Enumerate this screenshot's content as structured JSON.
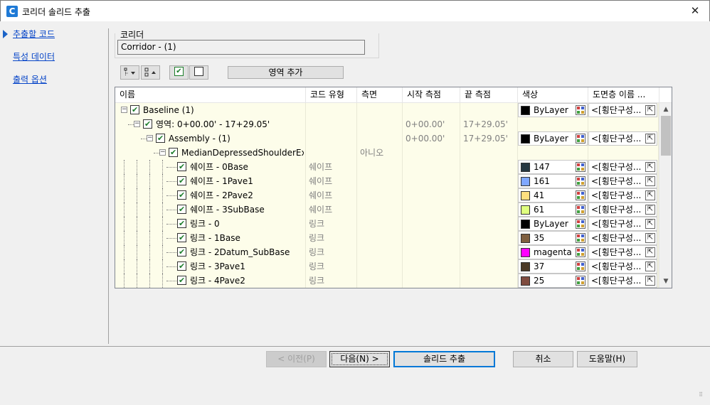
{
  "window": {
    "title": "코리더 솔리드 추출",
    "app_icon": "C",
    "close_glyph": "✕"
  },
  "nav": {
    "items": [
      {
        "label": "추출할 코드",
        "active": true
      },
      {
        "label": "특성 데이터",
        "active": false
      },
      {
        "label": "출력 옵션",
        "active": false
      }
    ]
  },
  "corridor": {
    "group_label": "코리더",
    "value": "Corridor - (1)"
  },
  "toolbar": {
    "expand_icon": "expand-all-icon",
    "collapse_icon": "collapse-all-icon",
    "check_all_icon": "check-all-icon",
    "uncheck_all_icon": "uncheck-all-icon",
    "add_region_label": "영역 추가"
  },
  "grid": {
    "columns": [
      "이름",
      "코드 유형",
      "측면",
      "시작 측점",
      "끝 측점",
      "색상",
      "도면층 이름 ..."
    ],
    "rows": [
      {
        "name": "Baseline (1)",
        "code_type": "",
        "side": "",
        "start": "",
        "end": "",
        "color_name": "ByLayer",
        "color_hex": "#000000",
        "layer": "<[횡단구성..."
      },
      {
        "name": "영역: 0+00.00' - 17+29.05'",
        "code_type": "",
        "side": "",
        "start": "0+00.00'",
        "end": "17+29.05'",
        "color_name": "",
        "color_hex": "",
        "layer": ""
      },
      {
        "name": "Assembly - (1)",
        "code_type": "",
        "side": "",
        "start": "0+00.00'",
        "end": "17+29.05'",
        "color_name": "ByLayer",
        "color_hex": "#000000",
        "layer": "<[횡단구성..."
      },
      {
        "name": "MedianDepressedShoulderExt",
        "code_type": "",
        "side": "아니오",
        "start": "",
        "end": "",
        "color_name": "",
        "color_hex": "",
        "layer": ""
      },
      {
        "name": "쉐이프 - 0Base",
        "code_type": "쉐이프",
        "side": "",
        "start": "",
        "end": "",
        "color_name": "147",
        "color_hex": "#263740",
        "layer": "<[횡단구성..."
      },
      {
        "name": "쉐이프 - 1Pave1",
        "code_type": "쉐이프",
        "side": "",
        "start": "",
        "end": "",
        "color_name": "161",
        "color_hex": "#7fa7ff",
        "layer": "<[횡단구성..."
      },
      {
        "name": "쉐이프 - 2Pave2",
        "code_type": "쉐이프",
        "side": "",
        "start": "",
        "end": "",
        "color_name": "41",
        "color_hex": "#ffdf7f",
        "layer": "<[횡단구성..."
      },
      {
        "name": "쉐이프 - 3SubBase",
        "code_type": "쉐이프",
        "side": "",
        "start": "",
        "end": "",
        "color_name": "61",
        "color_hex": "#dfff7f",
        "layer": "<[횡단구성..."
      },
      {
        "name": "링크 - 0",
        "code_type": "링크",
        "side": "",
        "start": "",
        "end": "",
        "color_name": "ByLayer",
        "color_hex": "#000000",
        "layer": "<[횡단구성..."
      },
      {
        "name": "링크 - 1Base",
        "code_type": "링크",
        "side": "",
        "start": "",
        "end": "",
        "color_name": "35",
        "color_hex": "#7f5f3f",
        "layer": "<[횡단구성..."
      },
      {
        "name": "링크 - 2Datum_SubBase",
        "code_type": "링크",
        "side": "",
        "start": "",
        "end": "",
        "color_name": "magenta",
        "color_hex": "#ff00ff",
        "layer": "<[횡단구성..."
      },
      {
        "name": "링크 - 3Pave1",
        "code_type": "링크",
        "side": "",
        "start": "",
        "end": "",
        "color_name": "37",
        "color_hex": "#4c3a26",
        "layer": "<[횡단구성..."
      },
      {
        "name": "링크 - 4Pave2",
        "code_type": "링크",
        "side": "",
        "start": "",
        "end": "",
        "color_name": "25",
        "color_hex": "#7f4c3f",
        "layer": "<[횡단구성..."
      }
    ]
  },
  "buttons": {
    "prev": "< 이전(P)",
    "next": "다음(N) >",
    "extract": "솔리드 추출",
    "cancel": "취소",
    "help": "도움말(H)"
  }
}
